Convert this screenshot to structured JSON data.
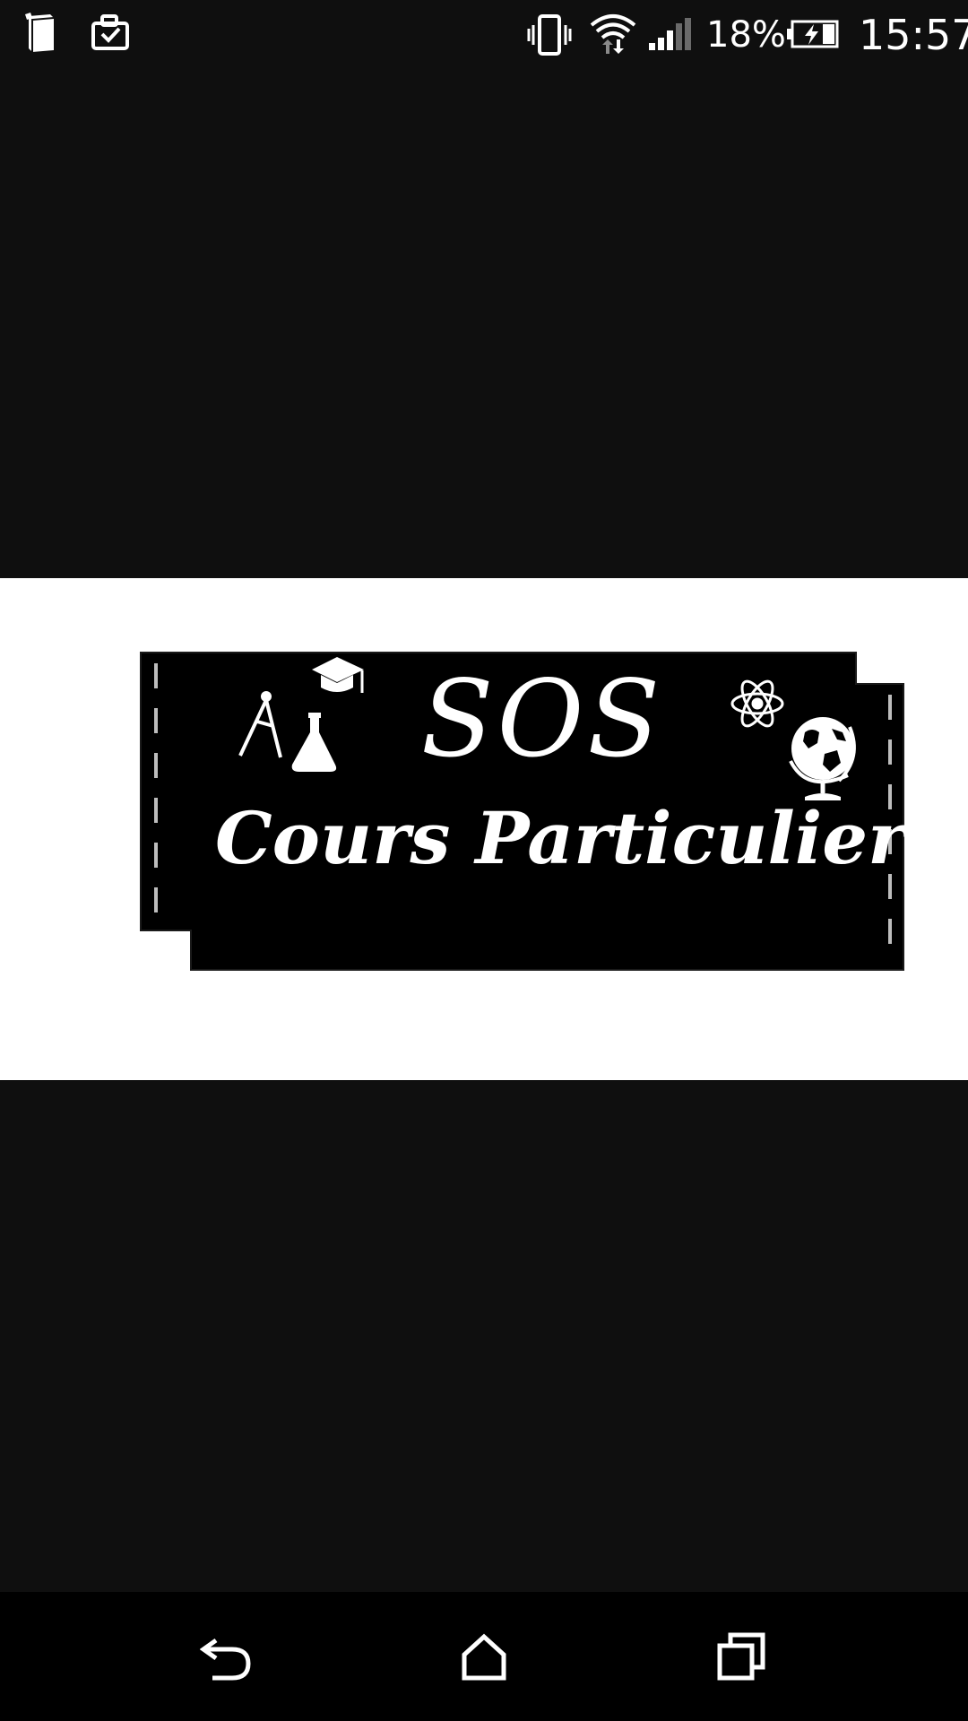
{
  "status_bar": {
    "battery_percent": "18%",
    "time": "15:57",
    "icons": {
      "notifications": [
        "book-icon",
        "briefcase-check-icon"
      ],
      "system": [
        "vibrate-icon",
        "wifi-icon",
        "cell-signal-icon",
        "battery-charging-icon"
      ]
    }
  },
  "viewer": {
    "logo": {
      "title": "SOS",
      "subtitle": "Cours Particuliers",
      "icons": [
        "compass-icon",
        "graduation-cap-icon",
        "flask-icon",
        "atom-icon",
        "globe-icon"
      ]
    }
  },
  "nav_bar": {
    "icons": [
      "back-icon",
      "home-icon",
      "recents-icon"
    ]
  },
  "colors": {
    "background": "#0f0f0f",
    "image_background": "#ffffff",
    "logo_background": "#000000",
    "logo_text": "#ffffff",
    "nav_background": "#000000"
  }
}
